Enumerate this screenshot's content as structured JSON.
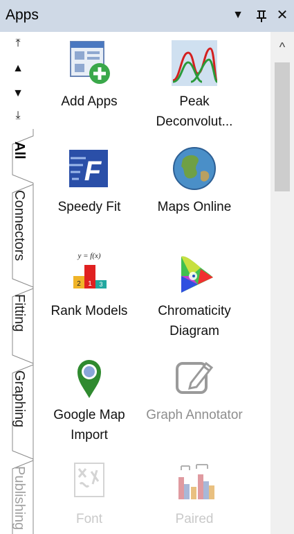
{
  "panel": {
    "title": "Apps"
  },
  "titlebar": {
    "menu_glyph": "▼",
    "pin_glyph": "ᴨ",
    "close_glyph": "✕"
  },
  "nav": {
    "first": "⤒",
    "up": "▲",
    "down": "▼",
    "last": "⤓"
  },
  "tabs": [
    {
      "label": "All",
      "active": true
    },
    {
      "label": "Connectors"
    },
    {
      "label": "Fitting"
    },
    {
      "label": "Graphing"
    },
    {
      "label": "Publishing"
    }
  ],
  "apps": [
    {
      "label": "Add Apps",
      "icon": "add-apps-icon"
    },
    {
      "label": "Peak Deconvolut...",
      "icon": "peak-deconvolution-icon"
    },
    {
      "label": "Speedy Fit",
      "icon": "speedy-fit-icon"
    },
    {
      "label": "Maps Online",
      "icon": "globe-icon"
    },
    {
      "label": "Rank Models",
      "icon": "rank-models-icon",
      "formula": "y = f(x)",
      "ranks": [
        "2",
        "1",
        "3"
      ]
    },
    {
      "label": "Chromaticity Diagram",
      "icon": "chromaticity-icon"
    },
    {
      "label": "Google Map Import",
      "icon": "map-pin-icon"
    },
    {
      "label": "Graph Annotator",
      "icon": "annotator-icon",
      "state": "disabled"
    },
    {
      "label": "Font",
      "icon": "font-icon",
      "state": "faded"
    },
    {
      "label": "Paired",
      "icon": "paired-comparison-icon",
      "state": "faded"
    }
  ],
  "scrollbar": {
    "up_glyph": "^"
  }
}
